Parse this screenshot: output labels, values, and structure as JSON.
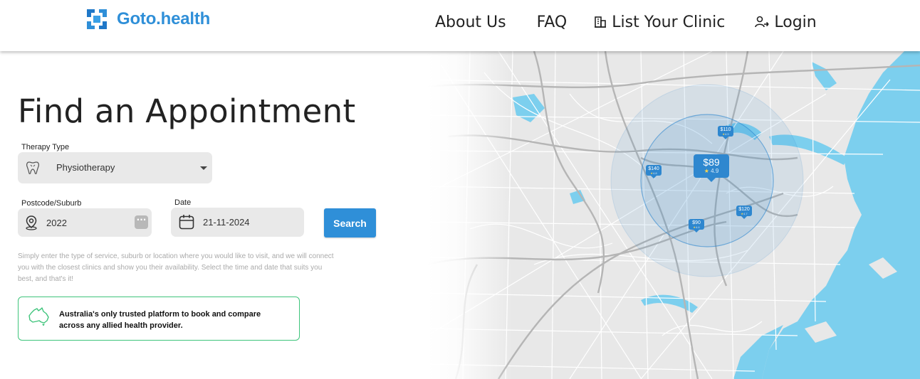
{
  "header": {
    "brand": "Goto.health",
    "brand_color": "#2f8fd8",
    "logo_icon": "goto-health-logo",
    "nav": {
      "about": "About Us",
      "faq": "FAQ",
      "list_clinic": "List Your Clinic",
      "list_clinic_icon": "clinic-building-icon",
      "login": "Login",
      "login_icon": "user-add-icon"
    }
  },
  "main": {
    "title": "Find an Appointment",
    "therapy": {
      "label": "Therapy Type",
      "value": "Physiotherapy",
      "icon": "tooth-icon"
    },
    "postcode": {
      "label": "Postcode/Suburb",
      "value": "2022",
      "icon": "location-pin-icon",
      "action_icon": "more-dots-icon"
    },
    "date": {
      "label": "Date",
      "value": "21-11-2024",
      "icon": "calendar-icon"
    },
    "search_label": "Search",
    "search_color": "#2f8fd8",
    "helper_text": "Simply enter the type of service, suburb or location where you would like to visit, and we will connect you with the closest clinics and show you their availability. Select the time and date that suits you best, and that's it!",
    "trust": {
      "icon": "australia-map-icon",
      "text": "Australia's only trusted platform to book and compare across any allied health provider.",
      "border_color": "#3ec47b"
    }
  },
  "map": {
    "water_color": "#7ccfee",
    "radius_color": "#2e87cf",
    "pins": [
      {
        "price": "$110",
        "rating": "4.9"
      },
      {
        "price": "$140",
        "rating": "4.8"
      },
      {
        "price": "$89",
        "rating": "4.9"
      },
      {
        "price": "$120",
        "rating": "4.7"
      },
      {
        "price": "$90",
        "rating": "4.6"
      }
    ]
  }
}
